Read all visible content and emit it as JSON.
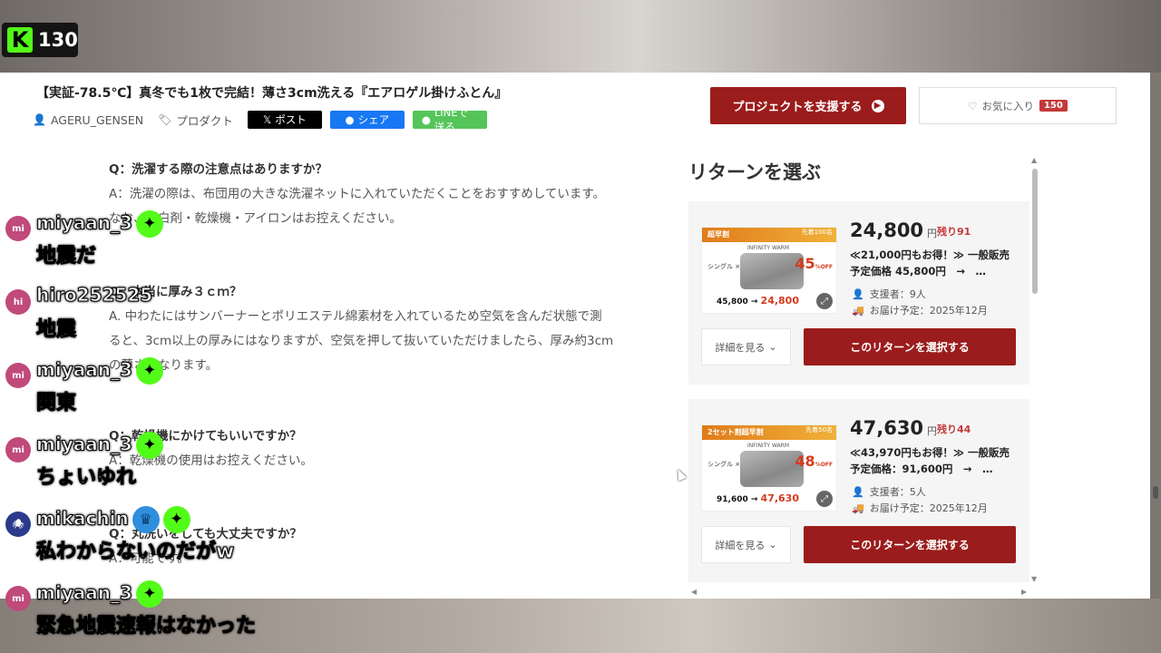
{
  "stream": {
    "viewer_count": "130",
    "platform_icon": "kick-logo"
  },
  "page": {
    "title": "【実証-78.5℃】真冬でも1枚で完結！薄さ3cm洗える『エアロゲル掛けふとん』",
    "author": "AGERU_GENSEN",
    "category": "プロダクト",
    "share": {
      "x": "ポスト",
      "facebook": "シェア",
      "line": "LINEで送る"
    },
    "support_button": "プロジェクトを支援する",
    "favorite_label": "お気に入り",
    "favorite_count": "150"
  },
  "faq": [
    {
      "q": "Q：洗濯する際の注意点はありますか？",
      "a": [
        "A：洗濯の際は、布団用の大きな洗濯ネットに入れていただくことをおすすめしています。",
        "なお、漂白剤・乾燥機・アイロンはお控えください。"
      ]
    },
    {
      "q": "Q：本当に厚み３ｃｍ？",
      "a": [
        "A. 中わたにはサンバーナーとポリエステル綿素材を入れているため空気を含んだ状態で測",
        "ると、3cm以上の厚みにはなりますが、空気を押して抜いていただけましたら、厚み約3cm",
        "の薄さになります。"
      ]
    },
    {
      "q": "Q：乾燥機にかけてもいいですか？",
      "a": [
        "A：乾燥機の使用はお控えください。"
      ]
    },
    {
      "q": "Q：丸洗いをしても大丈夫ですか？",
      "a": [
        "A：可能です。"
      ]
    }
  ],
  "returns": {
    "title": "リターンを選ぶ",
    "items": [
      {
        "ribbon": "超早割",
        "ribbon_note": "先着100名",
        "brand": "INFINITY WARM",
        "qty": "シングル ×1",
        "off": "45",
        "img_old_price": "45,800",
        "img_new_price": "24,800",
        "price": "24,800",
        "yen": "円",
        "remaining": "残り91",
        "desc1": "≪21,000円もお得！≫ 一般販売",
        "desc2": "予定価格 45,800円　→　…",
        "backers": "支援者：9人",
        "delivery": "お届け予定：2025年12月",
        "detail": "詳細を見る",
        "select": "このリターンを選択する"
      },
      {
        "ribbon": "2セット割超早割",
        "ribbon_note": "先着50名",
        "brand": "INFINITY WARM",
        "qty": "シングル ×2",
        "off": "48",
        "img_old_price": "91,600",
        "img_new_price": "47,630",
        "price": "47,630",
        "yen": "円",
        "remaining": "残り44",
        "desc1": "≪43,970円もお得！≫ 一般販売",
        "desc2": "予定価格：91,600円　→　…",
        "backers": "支援者：5人",
        "delivery": "お届け予定：2025年12月",
        "detail": "詳細を見る",
        "select": "このリターンを選択する"
      }
    ]
  },
  "chat": [
    {
      "avatar": "mi",
      "user": "miyaan_3",
      "badges": [
        "star"
      ],
      "text": "地震だ"
    },
    {
      "avatar": "hi",
      "user": "hiro252525",
      "badges": [],
      "text": "地震"
    },
    {
      "avatar": "mi",
      "user": "miyaan_3",
      "badges": [
        "star"
      ],
      "text": "関東"
    },
    {
      "avatar": "mi",
      "user": "miyaan_3",
      "badges": [
        "star"
      ],
      "text": "ちょいゆれ"
    },
    {
      "avatar": "",
      "user": "mikachin",
      "badges": [
        "crown",
        "star"
      ],
      "text": "私わからないのだがw"
    },
    {
      "avatar": "mi",
      "user": "miyaan_3",
      "badges": [
        "star"
      ],
      "text": "緊急地震速報はなかった"
    }
  ]
}
